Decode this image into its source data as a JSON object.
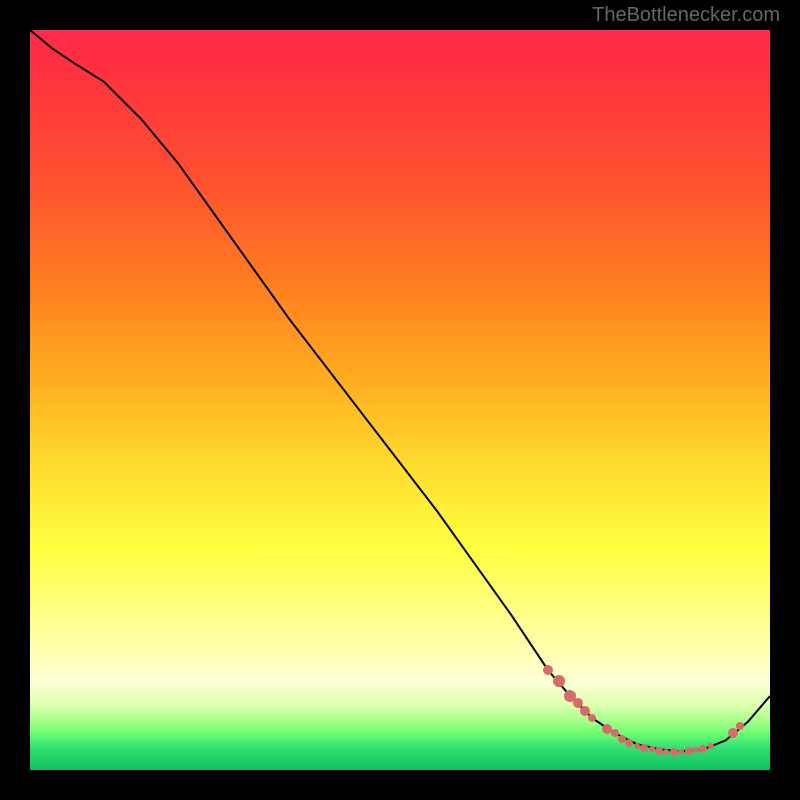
{
  "attribution": "TheBottlenecker.com",
  "chart_data": {
    "type": "line",
    "title": "",
    "xlabel": "",
    "ylabel": "",
    "xlim": [
      0,
      100
    ],
    "ylim": [
      0,
      100
    ],
    "series": [
      {
        "name": "curve",
        "x": [
          0,
          3,
          6,
          10,
          15,
          20,
          25,
          30,
          35,
          40,
          45,
          50,
          55,
          60,
          65,
          70,
          73,
          76,
          79,
          82,
          85,
          88,
          91,
          94,
          97,
          100
        ],
        "y": [
          100,
          97.5,
          95.5,
          93,
          88,
          82,
          75,
          68,
          61,
          54.5,
          48,
          41.5,
          35,
          28,
          21,
          13.5,
          10,
          7,
          5,
          3.5,
          2.8,
          2.5,
          2.8,
          4,
          6.5,
          10
        ]
      }
    ],
    "highlight_points": {
      "name": "dots",
      "points": [
        {
          "x": 70,
          "y": 13.5,
          "r": 5
        },
        {
          "x": 71.5,
          "y": 12,
          "r": 6
        },
        {
          "x": 73,
          "y": 10,
          "r": 6
        },
        {
          "x": 74,
          "y": 9,
          "r": 5
        },
        {
          "x": 75,
          "y": 8,
          "r": 5
        },
        {
          "x": 76,
          "y": 7,
          "r": 4
        },
        {
          "x": 78,
          "y": 5.5,
          "r": 5
        },
        {
          "x": 79,
          "y": 5,
          "r": 4
        },
        {
          "x": 80,
          "y": 4.2,
          "r": 4
        },
        {
          "x": 81,
          "y": 3.7,
          "r": 4
        },
        {
          "x": 82,
          "y": 3.3,
          "r": 3
        },
        {
          "x": 83,
          "y": 3.0,
          "r": 4
        },
        {
          "x": 84,
          "y": 2.8,
          "r": 3
        },
        {
          "x": 85,
          "y": 2.6,
          "r": 4
        },
        {
          "x": 86,
          "y": 2.5,
          "r": 3
        },
        {
          "x": 87,
          "y": 2.5,
          "r": 4
        },
        {
          "x": 88,
          "y": 2.5,
          "r": 3
        },
        {
          "x": 89,
          "y": 2.6,
          "r": 4
        },
        {
          "x": 90,
          "y": 2.7,
          "r": 3
        },
        {
          "x": 91,
          "y": 2.9,
          "r": 4
        },
        {
          "x": 92,
          "y": 3.2,
          "r": 3
        },
        {
          "x": 95,
          "y": 5.0,
          "r": 5
        },
        {
          "x": 96,
          "y": 6.0,
          "r": 4
        }
      ]
    },
    "colors": {
      "curve": "#000000",
      "dots": "#d66b6b"
    }
  }
}
